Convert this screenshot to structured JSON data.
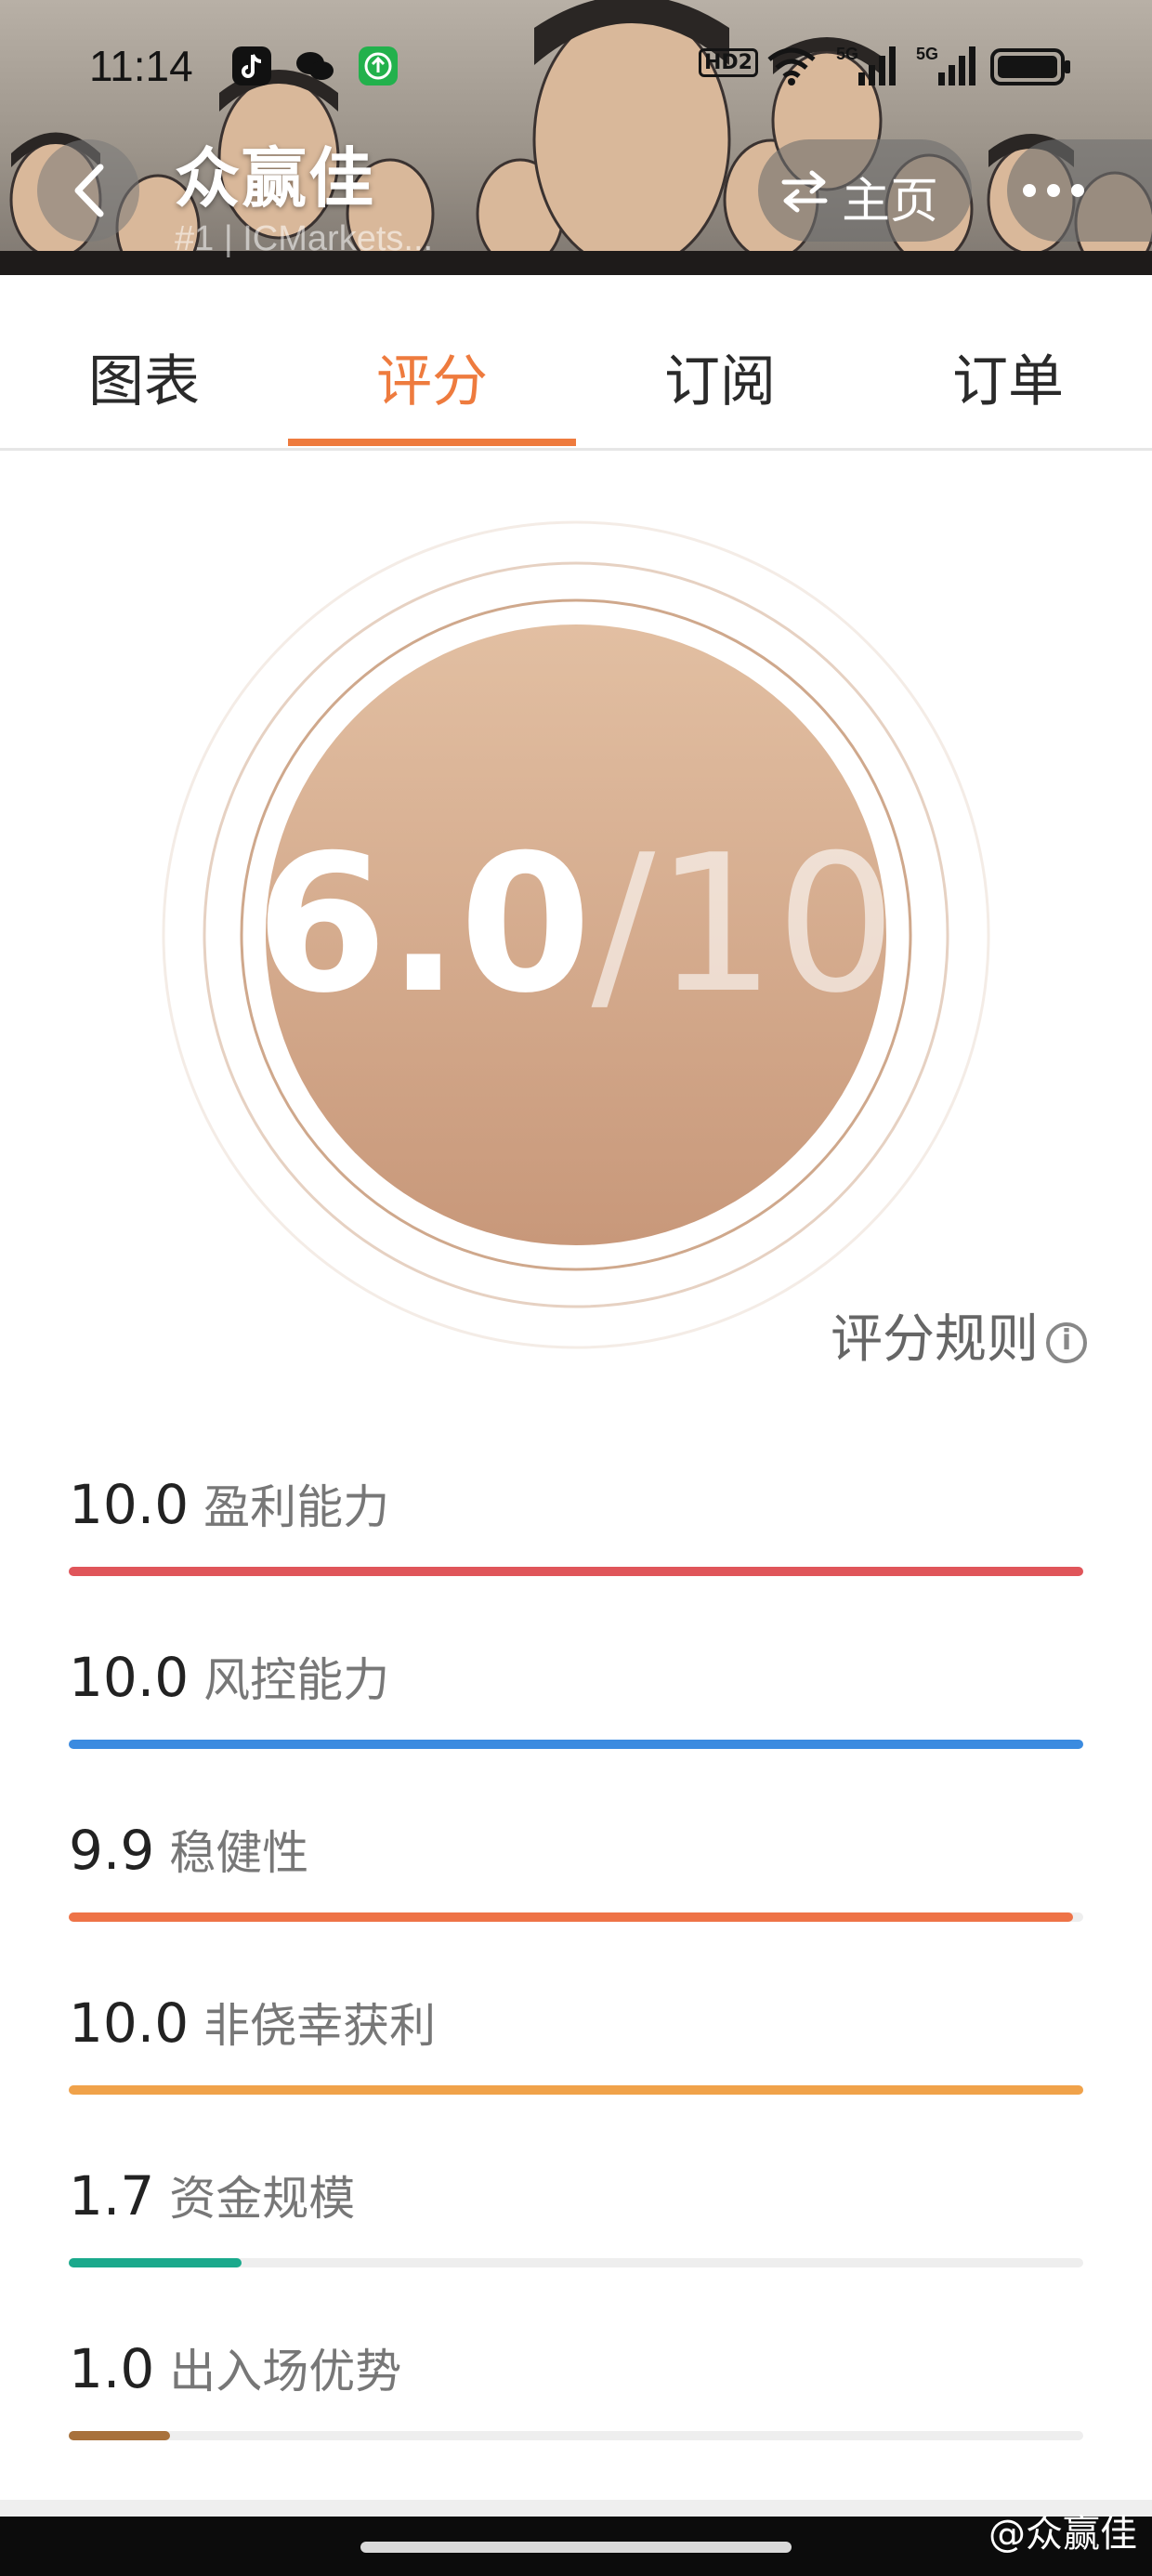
{
  "status_bar": {
    "time": "11:14",
    "apps": [
      "tiktok-icon",
      "wechat-icon",
      "upload-icon"
    ],
    "network": [
      "HD2",
      "wifi-icon",
      "5G",
      "5G"
    ],
    "battery": "battery-icon"
  },
  "header": {
    "title": "众赢佳",
    "subtitle": "#1 | ICMarkets...",
    "home_label": "主页",
    "back_icon": "chevron-left-icon",
    "switch_icon": "swap-icon",
    "more_icon": "more-icon"
  },
  "tabs": [
    {
      "label": "图表",
      "active": false
    },
    {
      "label": "评分",
      "active": true
    },
    {
      "label": "订阅",
      "active": false
    },
    {
      "label": "订单",
      "active": false
    }
  ],
  "score": {
    "value": "6.0",
    "separator_total": "/10",
    "rules_label": "评分规则",
    "rules_icon": "info-icon"
  },
  "metrics": [
    {
      "value": "10.0",
      "label": "盈利能力",
      "score": 10.0,
      "max": 10,
      "color": "#e0555a"
    },
    {
      "value": "10.0",
      "label": "风控能力",
      "score": 10.0,
      "max": 10,
      "color": "#3b8be0"
    },
    {
      "value": "9.9",
      "label": "稳健性",
      "score": 9.9,
      "max": 10,
      "color": "#ee7347"
    },
    {
      "value": "10.0",
      "label": "非侥幸获利",
      "score": 10.0,
      "max": 10,
      "color": "#f0a24a"
    },
    {
      "value": "1.7",
      "label": "资金规模",
      "score": 1.7,
      "max": 10,
      "color": "#1aa98c"
    },
    {
      "value": "1.0",
      "label": "出入场优势",
      "score": 1.0,
      "max": 10,
      "color": "#a8713c"
    }
  ],
  "colors": {
    "accent": "#ee7b3e",
    "circle_top": "#e2bfa2",
    "circle_bottom": "#c8987a"
  },
  "watermark": "@众赢佳"
}
